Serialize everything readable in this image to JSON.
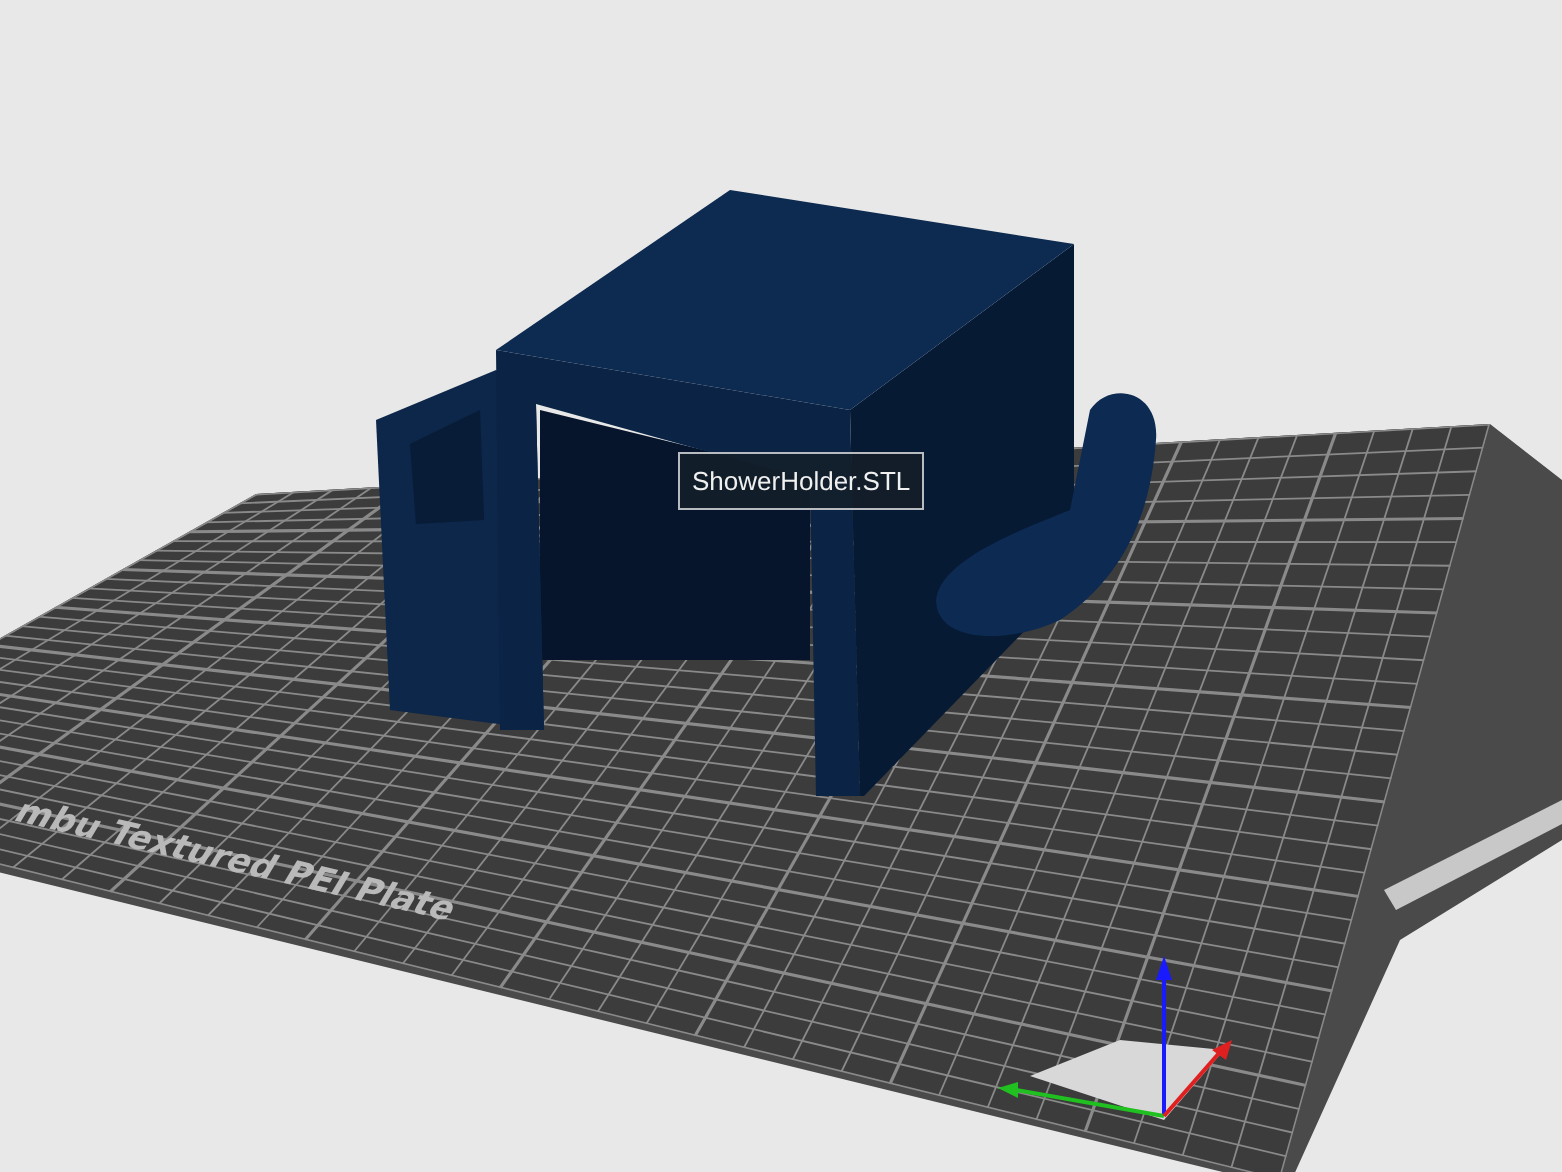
{
  "viewport": {
    "tooltip": "ShowerHolder.STL",
    "plate_label": "mbu Textured PEI Plate"
  }
}
